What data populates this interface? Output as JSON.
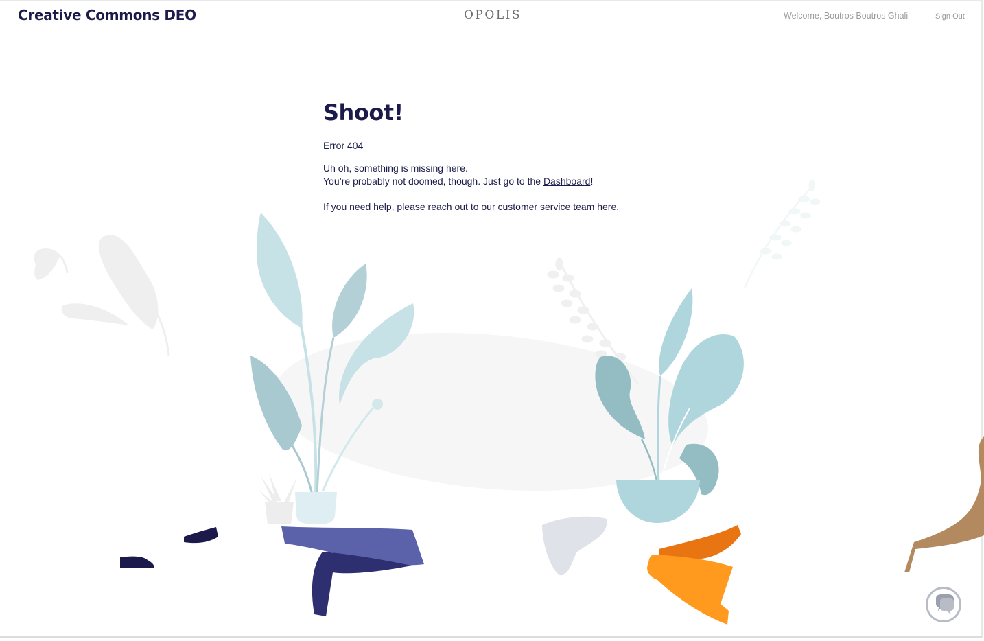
{
  "header": {
    "org_name": "Creative Commons DEO",
    "logo_text": "OPOLIS",
    "welcome_text": "Welcome, Boutros Boutros Ghali",
    "sign_out_label": "Sign Out"
  },
  "error_page": {
    "title": "Shoot!",
    "error_code": "Error 404",
    "missing_text": "Uh oh, something is missing here.",
    "doomed_prefix": "You’re probably not doomed, though. Just go to the ",
    "dashboard_link": "Dashboard",
    "doomed_suffix": "!",
    "help_prefix": "If you need help, please reach out to our customer service team ",
    "help_link": "here",
    "help_suffix": "."
  },
  "chat": {
    "icon": "chat-bubbles-icon"
  },
  "illustration": {
    "icon": "plants-and-people-illustration",
    "colors": {
      "leaf_light": "#c4e1e6",
      "leaf_mid": "#afd6dd",
      "leaf_dark": "#93bcc3",
      "purple": "#5c62aa",
      "navy": "#2d2f70",
      "orange": "#ff9a1f",
      "orange_dark": "#e87512",
      "skin": "#b38960",
      "ghost": "#efefef"
    }
  }
}
